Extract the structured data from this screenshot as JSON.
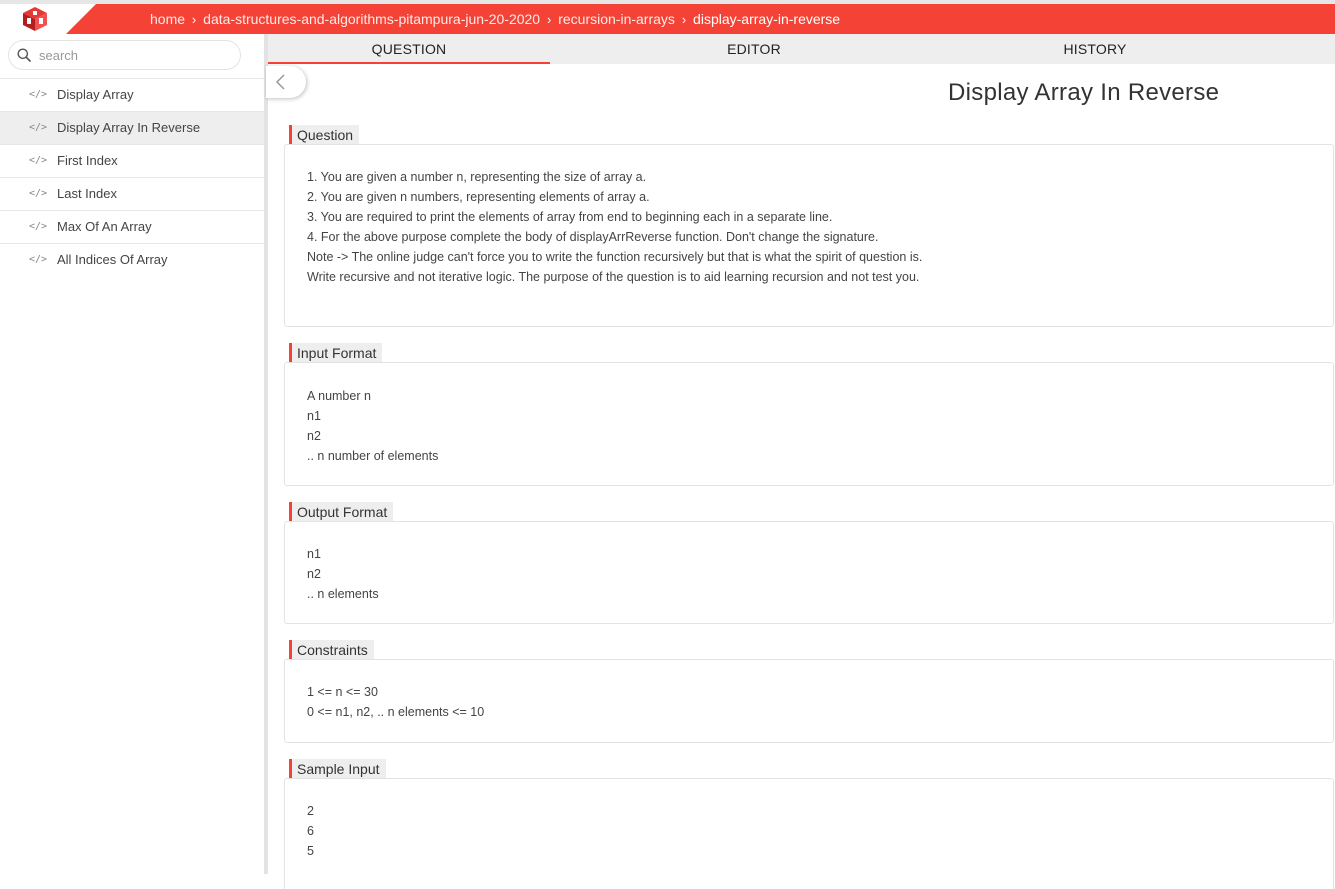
{
  "breadcrumb": {
    "items": [
      "home",
      "data-structures-and-algorithms-pitampura-jun-20-2020",
      "recursion-in-arrays",
      "display-array-in-reverse"
    ],
    "separator": "›"
  },
  "search": {
    "placeholder": "search",
    "value": ""
  },
  "sidebar": {
    "items": [
      {
        "icon": "</>",
        "label": "Display Array"
      },
      {
        "icon": "</>",
        "label": "Display Array In Reverse"
      },
      {
        "icon": "</>",
        "label": "First Index"
      },
      {
        "icon": "</>",
        "label": "Last Index"
      },
      {
        "icon": "</>",
        "label": "Max Of An Array"
      },
      {
        "icon": "</>",
        "label": "All Indices Of Array"
      }
    ],
    "active_index": 1
  },
  "tabs": [
    {
      "label": "QUESTION"
    },
    {
      "label": "EDITOR"
    },
    {
      "label": "HISTORY"
    }
  ],
  "active_tab": "QUESTION",
  "page_title": "Display Array In Reverse",
  "sections": {
    "question": {
      "heading": "Question",
      "lines": [
        "1. You are given a number n, representing the size of array a.",
        "2. You are given n numbers, representing elements of array a.",
        "3. You are required to print the elements of array from end to beginning each in a separate line.",
        "4. For the above purpose complete the body of displayArrReverse function. Don't change the signature.",
        "",
        "Note -> The online judge can't force you to write the function recursively but that is what the spirit of question is.",
        "Write recursive and not iterative logic. The purpose of the question is to aid learning recursion and not test you."
      ]
    },
    "input_format": {
      "heading": "Input Format",
      "lines": [
        "A number n",
        "n1",
        "n2",
        ".. n number of elements"
      ]
    },
    "output_format": {
      "heading": "Output Format",
      "lines": [
        "n1",
        "n2",
        ".. n elements"
      ]
    },
    "constraints": {
      "heading": "Constraints",
      "lines": [
        "1 <= n <= 30",
        "0 <= n1, n2, .. n elements <= 10"
      ]
    },
    "sample_input": {
      "heading": "Sample Input",
      "lines": [
        "2",
        "6",
        "5"
      ]
    }
  },
  "colors": {
    "accent": "#f44336",
    "tab_bar": "#eeeeee",
    "active_item": "#eeeeee"
  },
  "icons": {
    "logo": "pepcoding-logo",
    "search": "search-icon",
    "collapse": "chevron-left-icon",
    "list_item": "code-icon"
  }
}
